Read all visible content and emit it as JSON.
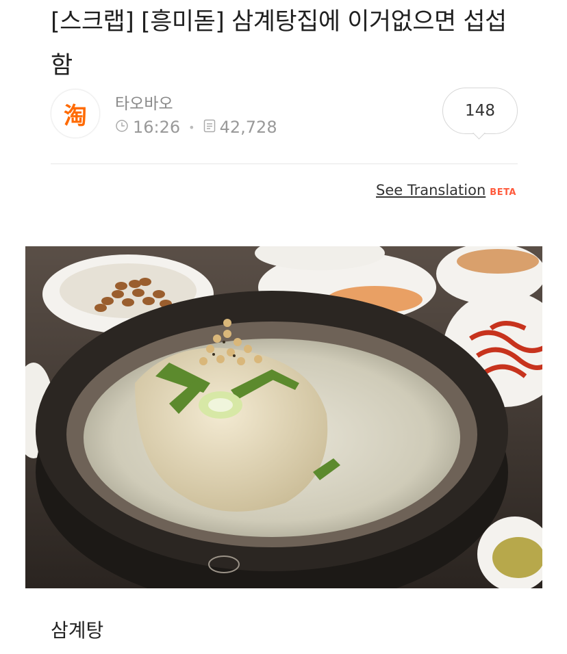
{
  "post": {
    "title": "[스크랩] [흥미돋] 삼계탕집에 이거없으면 섭섭함",
    "author": "타오바오",
    "time": "16:26",
    "views": "42,728",
    "comments": "148",
    "avatar_glyph": "淘"
  },
  "translation": {
    "link": "See Translation",
    "badge": "BETA"
  },
  "caption": "삼계탕",
  "icons": [
    "clock-icon",
    "document-icon",
    "comment-bubble-icon"
  ],
  "colors": {
    "accent": "#ff5a3c",
    "avatar": "#ff6a00",
    "meta": "#999999"
  }
}
